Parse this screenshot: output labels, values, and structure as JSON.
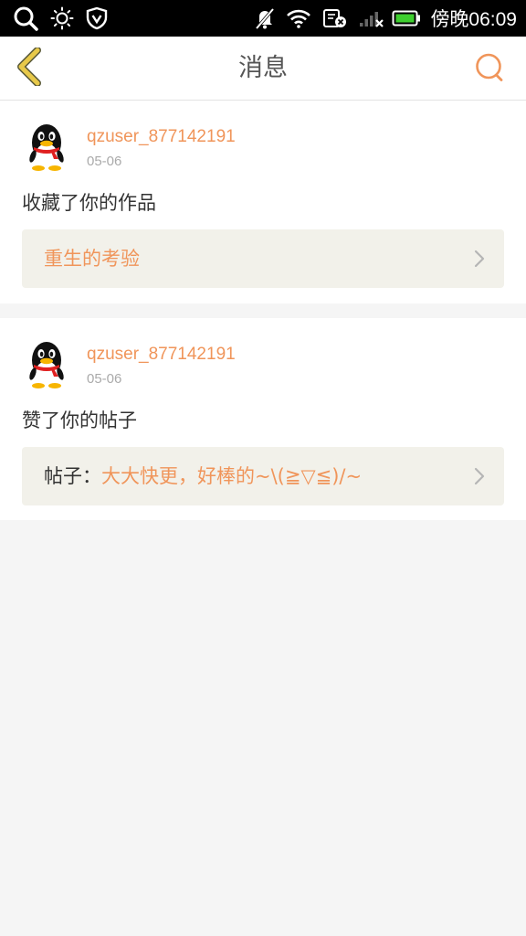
{
  "status_bar": {
    "time": "傍晚06:09",
    "icons": [
      "search-icon",
      "brightness-icon",
      "vpn-shield-icon",
      "mute-icon",
      "wifi-icon",
      "sim-icon",
      "signal-icon",
      "battery-icon"
    ]
  },
  "header": {
    "title": "消息",
    "back_icon": "chevron-left-icon",
    "search_icon": "search-icon"
  },
  "colors": {
    "accent": "#f0955a",
    "back_arrow": "#e8c94a",
    "card_bg": "#ffffff",
    "page_bg": "#f5f5f5",
    "target_bg": "#f2f1ea"
  },
  "messages": [
    {
      "username": "qzuser_877142191",
      "date": "05-06",
      "action": "收藏了你的作品",
      "target_prefix": "",
      "target_text": "重生的考验"
    },
    {
      "username": "qzuser_877142191",
      "date": "05-06",
      "action": "赞了你的帖子",
      "target_prefix": "帖子：",
      "target_text": "大大快更，好棒的~\\(≧▽≦)/~"
    }
  ]
}
